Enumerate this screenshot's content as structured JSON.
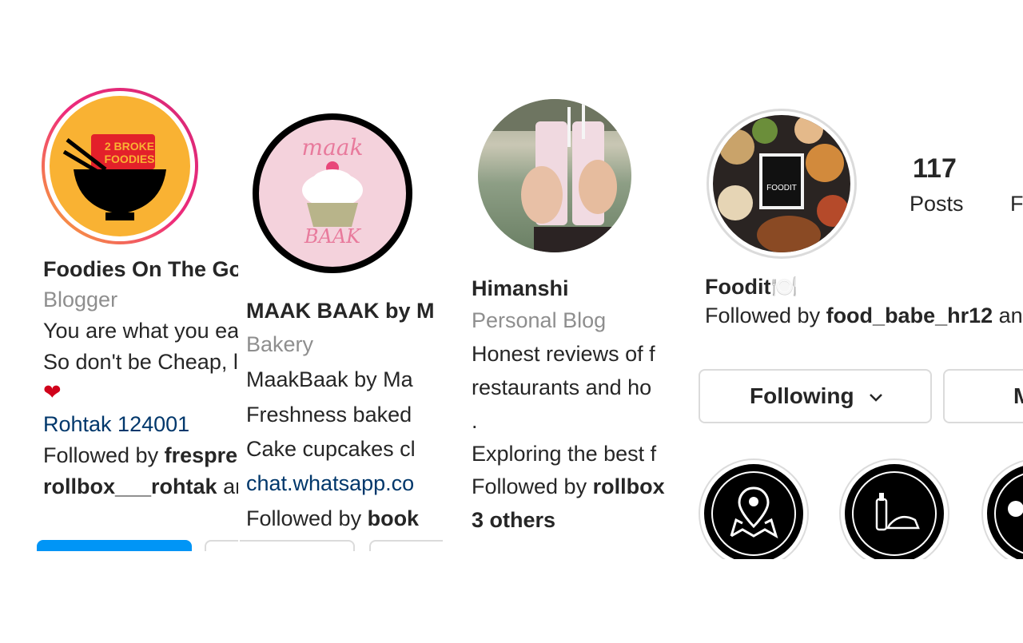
{
  "profiles": [
    {
      "logo_text": "2 BROKE\nFOODIES",
      "name": "Foodies On The Go",
      "category": "Blogger",
      "bio_line1": "You are what you ea",
      "bio_line2": "So don't be Cheap, l",
      "heart": "❤",
      "location": "Rohtak 124001",
      "followed_prefix": "Followed by ",
      "followed_user1": "frespre",
      "followed_user2": "rollbox___rohtak",
      "followed_suffix": " an"
    },
    {
      "logo_text_top": "maak",
      "logo_text_bottom": "BAAK",
      "name": "MAAK BAAK by M",
      "category": "Bakery",
      "bio_line1": "MaakBaak by Ma",
      "bio_line2": "Freshness baked",
      "bio_line3": "Cake cupcakes cl",
      "link": "chat.whatsapp.co",
      "followed_prefix": "Followed by ",
      "followed_user1": "book"
    },
    {
      "name": "Himanshi",
      "category": "Personal Blog",
      "bio_line1": "Honest reviews of f",
      "bio_line2": "restaurants and ho",
      "bio_line3": ".",
      "bio_line4": "Exploring the best f",
      "followed_prefix": "Followed by ",
      "followed_user1": "rollbox",
      "followed_user2": "3 others"
    },
    {
      "logo_text": "FOODIT",
      "stats_count": "117",
      "stats_label": "Posts",
      "stats_cut": "F",
      "name": "Foodit🍽️",
      "followed_prefix": "Followed by ",
      "followed_user1": "food_babe_hr12",
      "followed_suffix": " an",
      "following_button": "Following",
      "message_button_cut": "M",
      "highlights": [
        "location-map-icon",
        "bottle-food-icon",
        "partial-icon"
      ]
    }
  ],
  "colors": {
    "link": "#00376b",
    "secondary_text": "#8e8e8e",
    "follow_blue": "#0095f6",
    "border": "#dbdbdb",
    "logo_yellow": "#f9b233",
    "logo_red": "#e3202a",
    "maak_pink": "#f4d2dc"
  }
}
